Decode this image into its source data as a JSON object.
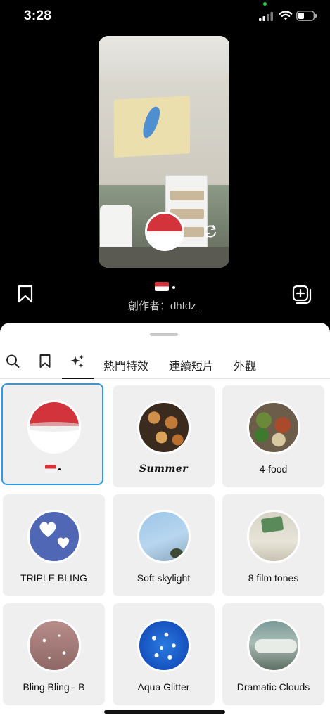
{
  "status_bar": {
    "time": "3:28"
  },
  "effect": {
    "name_suffix": "",
    "creator": "創作者：dhfdz_"
  },
  "tabs": [
    {
      "icon": "search-icon"
    },
    {
      "icon": "bookmark-icon"
    },
    {
      "icon": "sparkles-icon",
      "selected": true
    },
    {
      "label": "熱門特效"
    },
    {
      "label": "連續短片"
    },
    {
      "label": "外觀"
    }
  ],
  "effects": [
    {
      "label": "",
      "thumb": "flag",
      "selected": true
    },
    {
      "label": "Summer",
      "thumb": "flowers"
    },
    {
      "label": "4-food",
      "thumb": "food"
    },
    {
      "label": "TRIPLE BLING",
      "thumb": "hearts"
    },
    {
      "label": "Soft skylight",
      "thumb": "sky"
    },
    {
      "label": "8 film tones",
      "thumb": "film"
    },
    {
      "label": "Bling Bling - B",
      "thumb": "glitter-pink"
    },
    {
      "label": "Aqua Glitter",
      "thumb": "glitter-blue"
    },
    {
      "label": "Dramatic Clouds",
      "thumb": "clouds"
    }
  ],
  "colors": {
    "selected_border": "#2b9ae6",
    "flag_red": "#d3333b"
  }
}
